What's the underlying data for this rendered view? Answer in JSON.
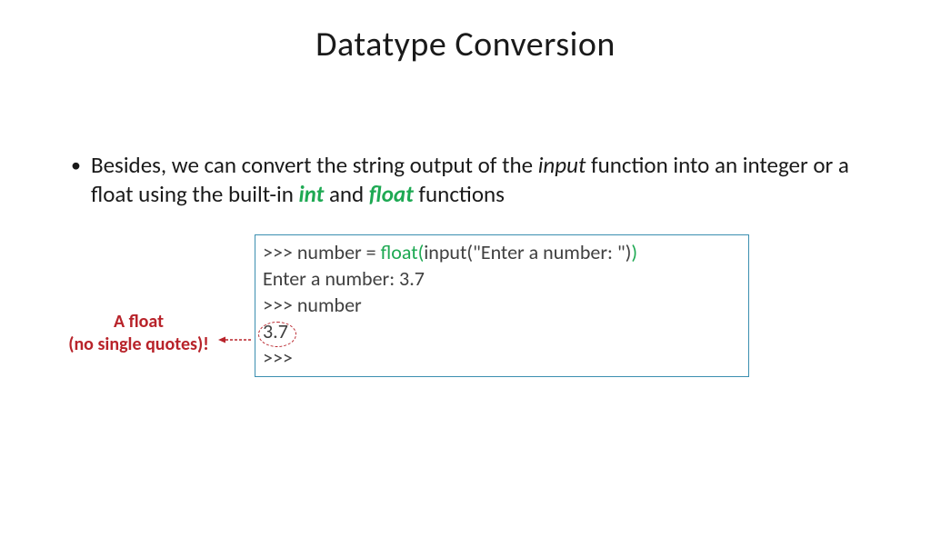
{
  "title": "Datatype Conversion",
  "bullet": {
    "pre": "Besides, we can convert the string output of the ",
    "inputWord": "input",
    "mid1": " function into an integer or a float using the built-in ",
    "kwInt": "int",
    "and": " and ",
    "kwFloat": "float",
    "post": " functions"
  },
  "code": {
    "l1a": ">>> number = ",
    "l1b": "float(",
    "l1c": "input(\"Enter a number: \")",
    "l1d": ")",
    "l2": "Enter a number: 3.7",
    "l3": ">>> number",
    "l4": "3.7",
    "l5": ">>>"
  },
  "callout": {
    "line1": "A float",
    "line2": "(no single quotes)!"
  }
}
